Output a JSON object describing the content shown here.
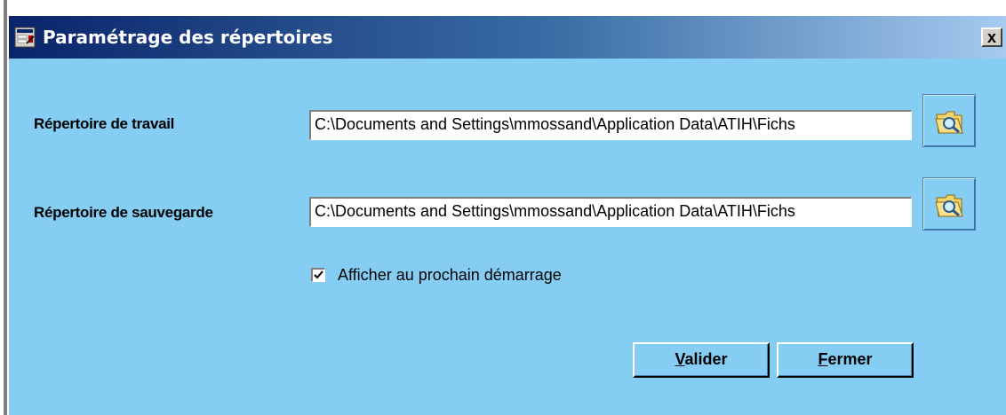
{
  "window": {
    "title": "Paramétrage des répertoires",
    "close_label": "x"
  },
  "work_dir": {
    "label": "Répertoire de travail",
    "value": "C:\\Documents and Settings\\mmossand\\Application Data\\ATIH\\Fichs"
  },
  "backup_dir": {
    "label": "Répertoire de sauvegarde",
    "value": "C:\\Documents and Settings\\mmossand\\Application Data\\ATIH\\Fichs"
  },
  "startup_option": {
    "label": "Afficher au prochain démarrage",
    "checked": true
  },
  "buttons": {
    "validate_mnemonic": "V",
    "validate_rest": "alider",
    "close_mnemonic": "F",
    "close_rest": "ermer"
  },
  "icons": {
    "app": "settings-window-icon",
    "browse": "folder-search-icon",
    "check": "checkmark-icon",
    "close": "close-icon"
  },
  "colors": {
    "dialog_bg": "#86cdf4",
    "titlebar_start": "#0a246a",
    "titlebar_end": "#a6caf0"
  }
}
